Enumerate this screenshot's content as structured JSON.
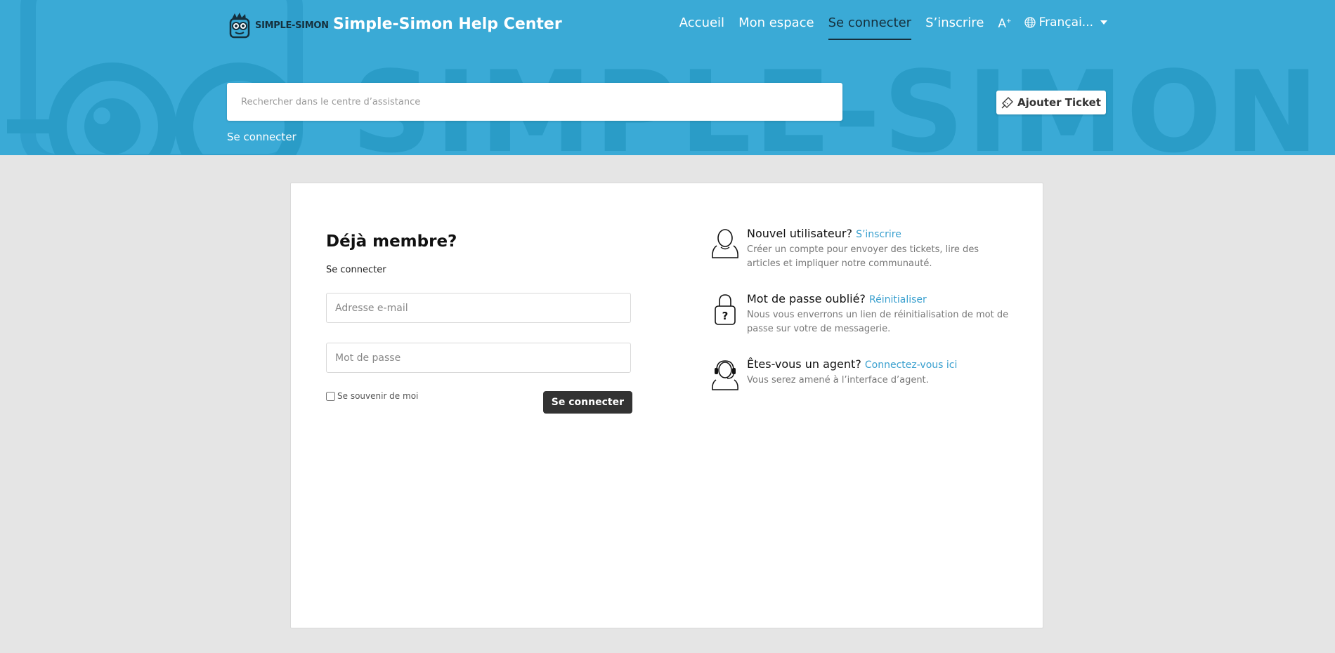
{
  "header": {
    "logo_text": "SIMPLE-SIMON",
    "site_title": "Simple-Simon Help Center",
    "watermark": "SIMPLE-SIMON",
    "nav": [
      {
        "label": "Accueil"
      },
      {
        "label": "Mon espace"
      },
      {
        "label": "Se connecter",
        "active": true
      },
      {
        "label": "S’inscrire"
      }
    ],
    "font_size_label": "A",
    "language_label": "Françai...",
    "search_placeholder": "Rechercher dans le centre d’assistance",
    "signin_link": "Se connecter",
    "add_ticket_label": "Ajouter Ticket",
    "colors": {
      "hero_bg": "#3aaad6",
      "hero_watermark": "#2a9cc7",
      "active_nav": "#15303d"
    }
  },
  "login": {
    "title": "Déjà membre?",
    "subtitle": "Se connecter",
    "email_placeholder": "Adresse e-mail",
    "password_placeholder": "Mot de passe",
    "remember_label": "Se souvenir de moi",
    "submit_label": "Se connecter"
  },
  "info": [
    {
      "icon": "user-icon",
      "question": "Nouvel utilisateur?",
      "link": "S’inscrire",
      "description": "Créer un compte pour envoyer des tickets, lire des articles et impliquer notre communauté."
    },
    {
      "icon": "lock-icon",
      "question": "Mot de passe oublié?",
      "link": "Réinitialiser",
      "description": "Nous vous enverrons un lien de réinitialisation de mot de passe sur votre de messagerie."
    },
    {
      "icon": "headset-icon",
      "question": "Êtes-vous un agent?",
      "link": "Connectez-vous ici",
      "description": "Vous serez amené à l’interface d’agent."
    }
  ]
}
